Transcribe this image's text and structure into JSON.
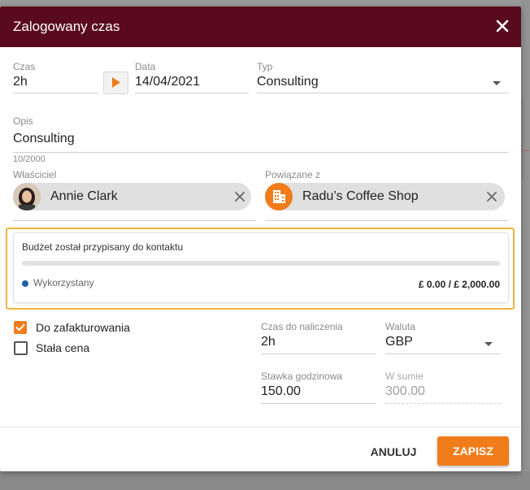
{
  "dialog": {
    "title": "Zalogowany czas",
    "close_icon": "close-icon",
    "header_color": "#5a0a1e"
  },
  "fields": {
    "time": {
      "label": "Czas",
      "value": "2h"
    },
    "date": {
      "label": "Data",
      "value": "14/04/2021"
    },
    "type": {
      "label": "Typ",
      "value": "Consulting"
    },
    "description": {
      "label": "Opis",
      "value": "Consulting",
      "counter": "10/2000"
    },
    "owner": {
      "label": "Właściciel",
      "value": "Annie Clark"
    },
    "related": {
      "label": "Powiązane z",
      "value": "Radu’s Coffee Shop"
    }
  },
  "budget": {
    "title": "Budżet został przypisany do kontaktu",
    "legend": "Wykorzystany",
    "amount": "£ 0.00 / £ 2,000.00",
    "used_fraction": 0,
    "highlight_color": "#f0b43c"
  },
  "options": {
    "billable": {
      "label": "Do zafakturowania",
      "checked": true
    },
    "fixed_price": {
      "label": "Stała cena",
      "checked": false
    }
  },
  "billing": {
    "billable_time": {
      "label": "Czas do naliczenia",
      "value": "2h"
    },
    "currency": {
      "label": "Waluta",
      "value": "GBP"
    },
    "hourly_rate": {
      "label": "Stawka godzinowa",
      "value": "150.00"
    },
    "total": {
      "label": "W sumie",
      "value": "300.00"
    }
  },
  "actions": {
    "cancel": "ANULUJ",
    "save": "ZAPISZ",
    "accent_color": "#f07c1a"
  }
}
